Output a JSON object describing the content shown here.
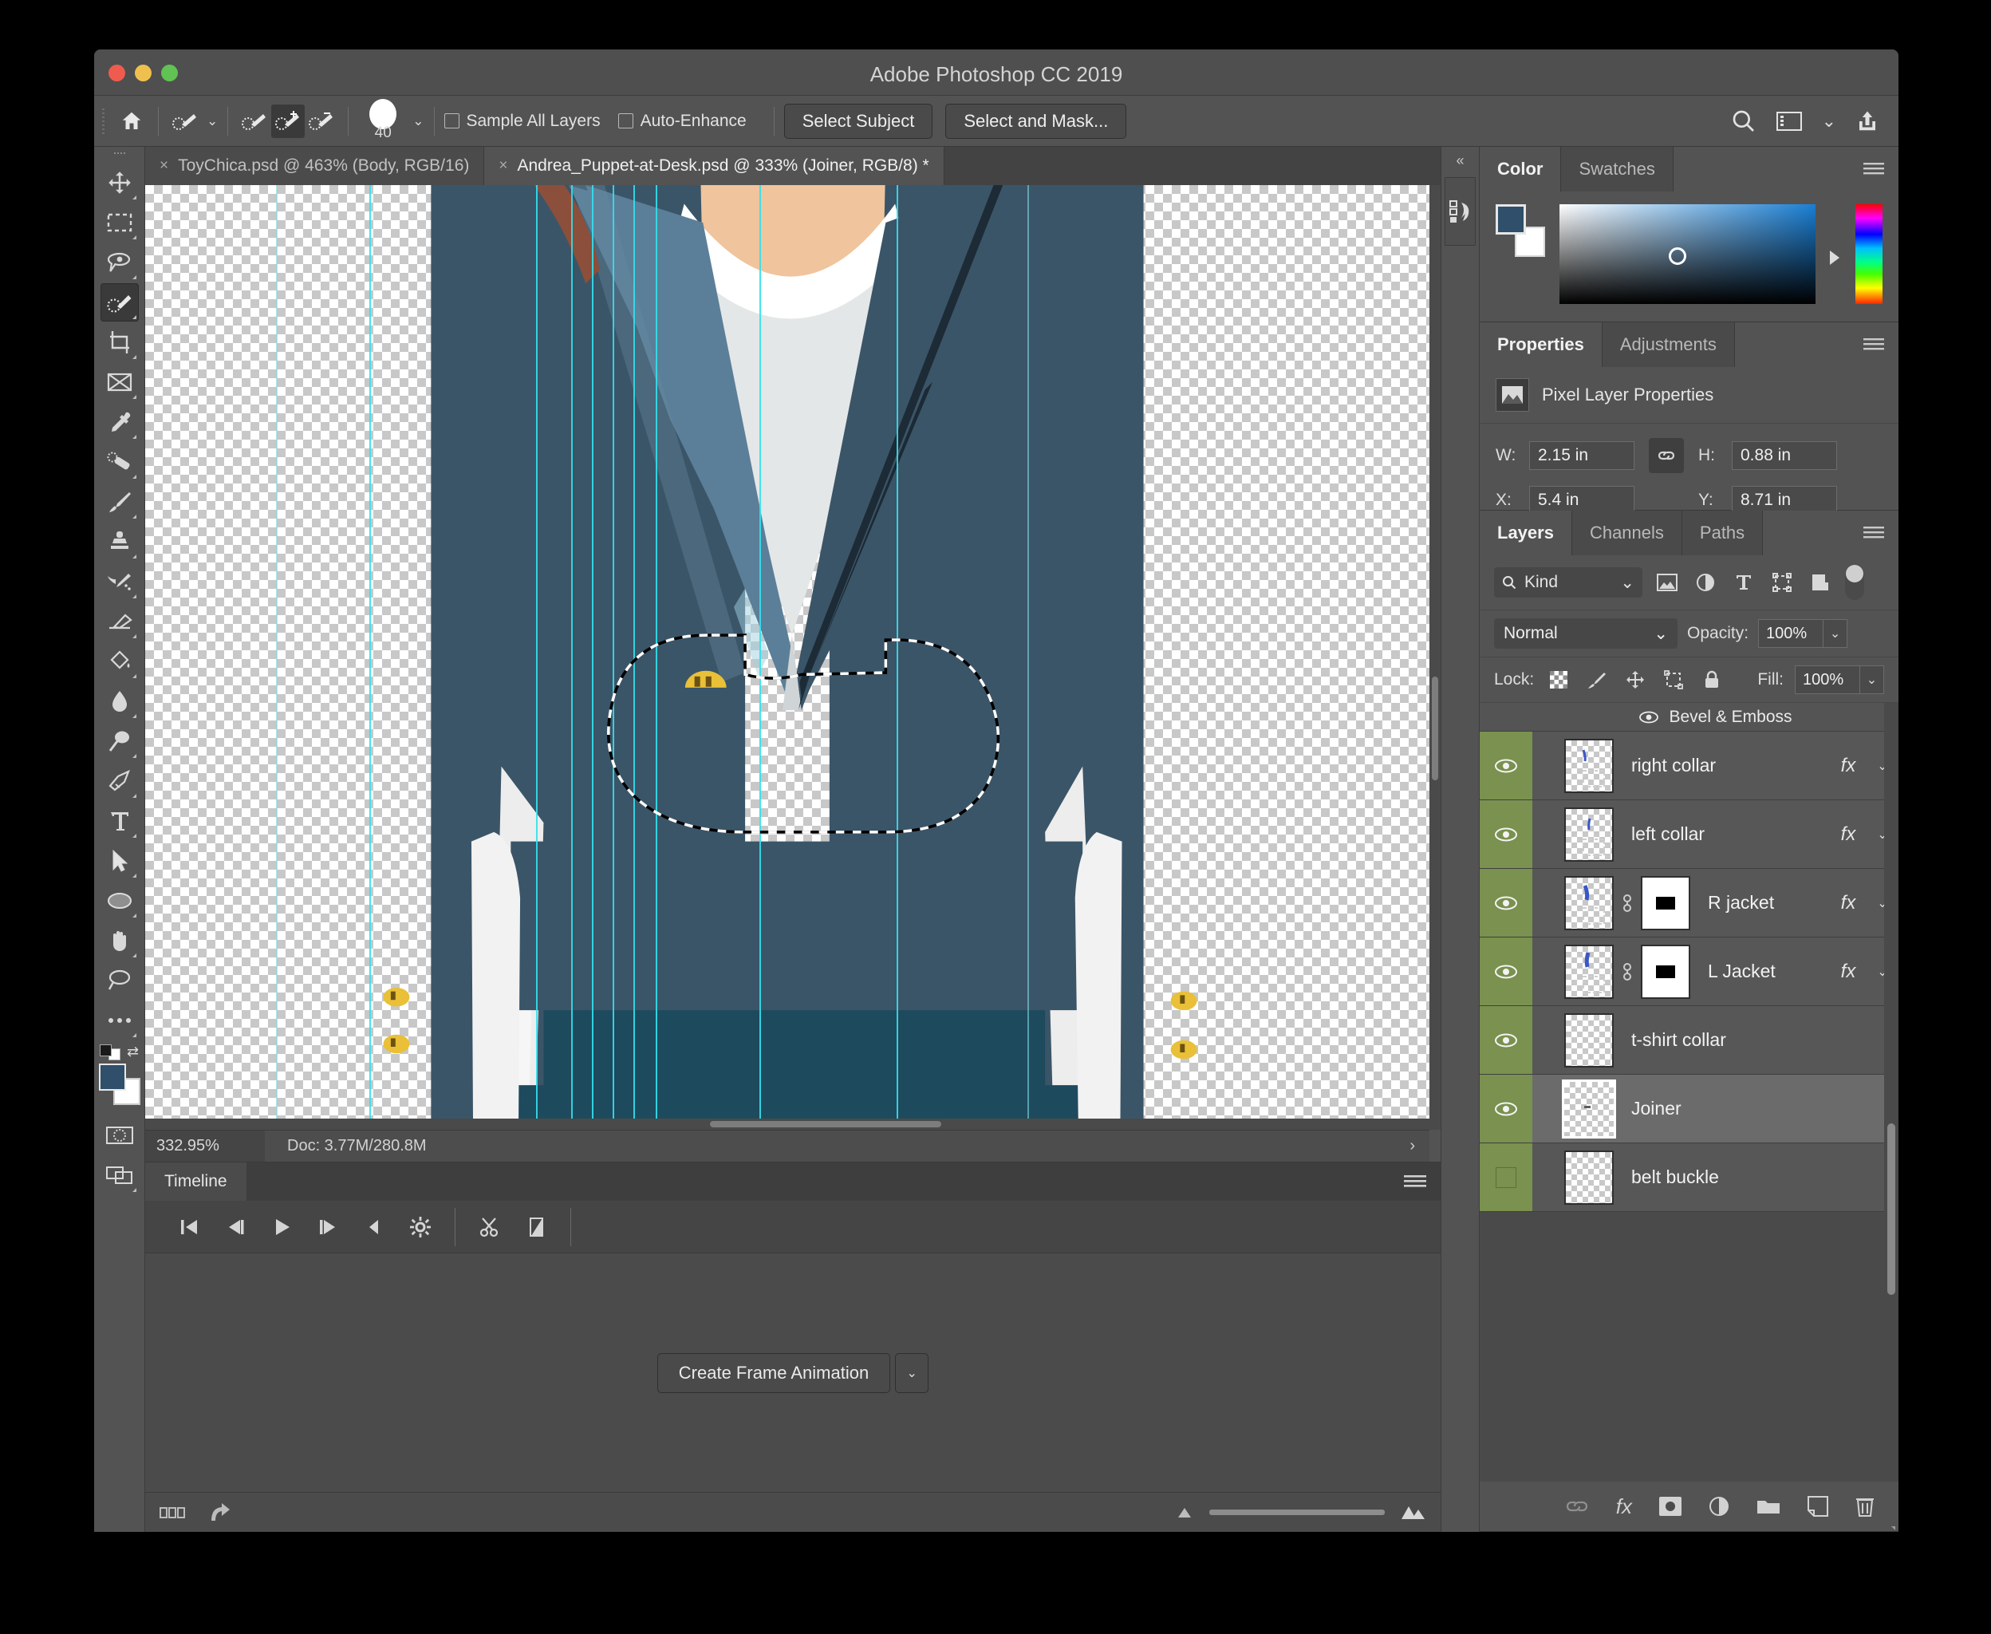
{
  "window": {
    "app_title": "Adobe Photoshop CC 2019",
    "traffic_lights": [
      "close",
      "minimize",
      "maximize"
    ]
  },
  "options_bar": {
    "home_icon": "home-icon",
    "tool_preset_icon": "quick-selection-tool-icon",
    "mode_new_icon": "selection-new-icon",
    "mode_add_icon": "selection-add-icon",
    "mode_subtract_icon": "selection-subtract-icon",
    "brush_size": "40",
    "sample_all_layers": "Sample All Layers",
    "auto_enhance": "Auto-Enhance",
    "select_subject": "Select Subject",
    "select_and_mask": "Select and Mask...",
    "search_icon": "search-icon",
    "workspace_icon": "workspace-icon",
    "share_icon": "share-icon"
  },
  "tools": [
    {
      "name": "move-tool",
      "icon": "move-icon"
    },
    {
      "name": "rectangular-marquee-tool",
      "icon": "marquee-icon"
    },
    {
      "name": "lasso-tool",
      "icon": "lasso-icon"
    },
    {
      "name": "quick-selection-tool",
      "icon": "quick-selection-icon",
      "selected": true
    },
    {
      "name": "crop-tool",
      "icon": "crop-icon"
    },
    {
      "name": "frame-tool",
      "icon": "frame-icon"
    },
    {
      "name": "eyedropper-tool",
      "icon": "eyedropper-icon"
    },
    {
      "name": "spot-healing-brush-tool",
      "icon": "healing-brush-icon"
    },
    {
      "name": "brush-tool",
      "icon": "brush-icon"
    },
    {
      "name": "clone-stamp-tool",
      "icon": "stamp-icon"
    },
    {
      "name": "history-brush-tool",
      "icon": "history-brush-icon"
    },
    {
      "name": "eraser-tool",
      "icon": "eraser-icon"
    },
    {
      "name": "gradient-tool",
      "icon": "paint-bucket-icon"
    },
    {
      "name": "blur-tool",
      "icon": "blur-drop-icon"
    },
    {
      "name": "dodge-tool",
      "icon": "dodge-icon"
    },
    {
      "name": "pen-tool",
      "icon": "pen-icon"
    },
    {
      "name": "type-tool",
      "icon": "type-t-icon"
    },
    {
      "name": "path-selection-tool",
      "icon": "path-arrow-icon"
    },
    {
      "name": "ellipse-tool",
      "icon": "ellipse-icon"
    },
    {
      "name": "hand-tool",
      "icon": "hand-icon"
    },
    {
      "name": "zoom-tool",
      "icon": "zoom-icon"
    },
    {
      "name": "edit-toolbar",
      "icon": "ellipsis-icon"
    }
  ],
  "document_tabs": [
    {
      "label": "ToyChica.psd @ 463% (Body, RGB/16)",
      "active": false,
      "close": "×"
    },
    {
      "label": "Andrea_Puppet-at-Desk.psd @ 333% (Joiner, RGB/8) *",
      "active": true,
      "close": "×"
    }
  ],
  "status_bar": {
    "zoom": "332.95%",
    "doc_info": "Doc: 3.77M/280.8M",
    "expand_arrow": "›"
  },
  "timeline": {
    "tab": "Timeline",
    "menu_icon": "panel-menu-icon",
    "controls": [
      {
        "name": "go-to-first-frame",
        "glyph": "first-frame-icon"
      },
      {
        "name": "previous-frame",
        "glyph": "previous-frame-icon"
      },
      {
        "name": "play",
        "glyph": "play-icon"
      },
      {
        "name": "next-frame",
        "glyph": "next-frame-icon"
      },
      {
        "name": "audio",
        "glyph": "audio-icon"
      },
      {
        "name": "settings",
        "glyph": "gear-icon"
      },
      {
        "name": "split-at-playhead",
        "glyph": "scissors-icon"
      },
      {
        "name": "transition",
        "glyph": "transition-icon"
      }
    ],
    "create_frame_animation": "Create Frame Animation",
    "create_frame_animation_arrow": "chevron-down-icon",
    "footer_icons": [
      "film-strip-icon",
      "render-video-icon",
      "zoom-out-icon",
      "zoom-in-icon"
    ]
  },
  "dock_strip": {
    "collapse": "«",
    "history_icon": "history-panel-icon"
  },
  "color_panel": {
    "tabs": [
      {
        "label": "Color",
        "active": true
      },
      {
        "label": "Swatches",
        "active": false
      }
    ],
    "menu_icon": "panel-menu-icon",
    "foreground_color": "#2f4f6b",
    "background_color": "#ffffff"
  },
  "properties_panel": {
    "tabs": [
      {
        "label": "Properties",
        "active": true
      },
      {
        "label": "Adjustments",
        "active": false
      }
    ],
    "menu_icon": "panel-menu-icon",
    "header": "Pixel Layer Properties",
    "header_icon": "pixel-layer-icon",
    "fields": [
      {
        "label": "W:",
        "value": "2.15 in"
      },
      {
        "label": "H:",
        "value": "0.88 in"
      },
      {
        "label": "X:",
        "value": "5.4 in"
      },
      {
        "label": "Y:",
        "value": "8.71 in"
      }
    ],
    "link_icon": "link-icon"
  },
  "layers_panel": {
    "tabs": [
      {
        "label": "Layers",
        "active": true
      },
      {
        "label": "Channels",
        "active": false
      },
      {
        "label": "Paths",
        "active": false
      }
    ],
    "menu_icon": "panel-menu-icon",
    "filter_kind": "Kind",
    "filter_icons": [
      "pixel-filter-icon",
      "adjustment-filter-icon",
      "type-filter-icon",
      "shape-filter-icon",
      "smart-object-filter-icon"
    ],
    "filter_toggle": "filter-enable-toggle",
    "blend_mode": "Normal",
    "opacity_label": "Opacity:",
    "opacity_value": "100%",
    "lock_label": "Lock:",
    "lock_icons": [
      "lock-transparent-pixels-icon",
      "lock-image-pixels-icon",
      "lock-position-icon",
      "lock-artboard-icon",
      "lock-all-icon"
    ],
    "fill_label": "Fill:",
    "fill_value": "100%",
    "effect_row": {
      "label": "Bevel & Emboss",
      "eye_icon": "eye-icon"
    },
    "layers": [
      {
        "name": "right collar",
        "visible": true,
        "has_mask": false,
        "has_fx": true,
        "selected": false
      },
      {
        "name": "left collar",
        "visible": true,
        "has_mask": false,
        "has_fx": true,
        "selected": false
      },
      {
        "name": "R jacket",
        "visible": true,
        "has_mask": true,
        "has_fx": true,
        "selected": false
      },
      {
        "name": "L Jacket",
        "visible": true,
        "has_mask": true,
        "has_fx": true,
        "selected": false
      },
      {
        "name": "t-shirt collar",
        "visible": true,
        "has_mask": false,
        "has_fx": false,
        "selected": false
      },
      {
        "name": "Joiner",
        "visible": true,
        "has_mask": false,
        "has_fx": false,
        "selected": true
      },
      {
        "name": "belt buckle",
        "visible": false,
        "has_mask": false,
        "has_fx": false,
        "selected": false
      }
    ],
    "footer_icons": [
      "link-layers-icon",
      "add-layer-style-icon",
      "add-layer-mask-icon",
      "new-fill-adjustment-icon",
      "new-group-icon",
      "new-layer-icon",
      "delete-layer-icon"
    ]
  },
  "canvas": {
    "description": "Vector illustration of a person in a dark blue-grey suit jacket over a white t-shirt, shown from chest to waist, on a transparent checkerboard background with cyan vertical guides and an active marching-ants selection around the belt area",
    "colors": {
      "jacket": "#3b5568",
      "jacket_lapel": "#5b7f99",
      "jacket_shadow": "#2e4354",
      "shirt": "#e4e7e8",
      "skin": "#f0c49c",
      "pants": "#1e4a5e",
      "buckle": "#e9c037",
      "guide": "#34e0ec"
    }
  }
}
